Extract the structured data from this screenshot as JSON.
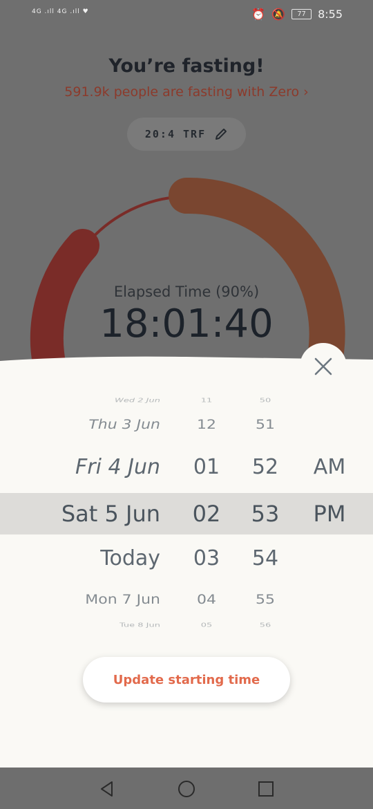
{
  "status_bar": {
    "signal_left": "4G .ıll 4G .ıll ♥",
    "battery": "77",
    "time": "8:55"
  },
  "header": {
    "title": "You’re fasting!",
    "subtitle": "591.9k people are fasting with Zero ›",
    "plan_label": "20:4 TRF"
  },
  "timer": {
    "elapsed_label": "Elapsed Time (90%)",
    "elapsed_time": "18:01:40",
    "progress": 0.9
  },
  "picker": {
    "dates": [
      "Wed 2 Jun",
      "Thu 3 Jun",
      "Fri 4 Jun",
      "Sat 5 Jun",
      "Today",
      "Mon 7 Jun",
      "Tue 8 Jun"
    ],
    "hours": [
      "11",
      "12",
      "01",
      "02",
      "03",
      "04",
      "05"
    ],
    "minutes": [
      "50",
      "51",
      "52",
      "53",
      "54",
      "55",
      "56"
    ],
    "ampm": [
      "AM",
      "PM"
    ],
    "selected": {
      "date": "Sat 5 Jun",
      "hour": "02",
      "minute": "53",
      "ampm": "PM"
    }
  },
  "actions": {
    "update_label": "Update starting time"
  },
  "icons": {
    "close": "close-icon",
    "edit": "pencil-icon",
    "nav_back": "back-triangle-icon",
    "nav_home": "home-circle-icon",
    "nav_recent": "recent-square-icon"
  },
  "colors": {
    "accent": "#e26a4c",
    "ring_start": "#7a2c28",
    "ring_end": "#7a4630",
    "sheet": "#faf9f5"
  }
}
